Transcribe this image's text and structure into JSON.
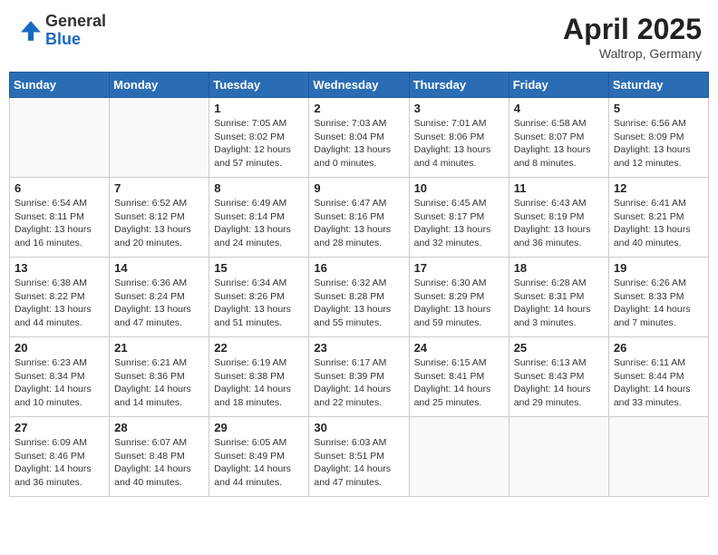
{
  "header": {
    "logo_general": "General",
    "logo_blue": "Blue",
    "title": "April 2025",
    "location": "Waltrop, Germany"
  },
  "weekdays": [
    "Sunday",
    "Monday",
    "Tuesday",
    "Wednesday",
    "Thursday",
    "Friday",
    "Saturday"
  ],
  "weeks": [
    [
      {
        "day": "",
        "info": ""
      },
      {
        "day": "",
        "info": ""
      },
      {
        "day": "1",
        "info": "Sunrise: 7:05 AM\nSunset: 8:02 PM\nDaylight: 12 hours and 57 minutes."
      },
      {
        "day": "2",
        "info": "Sunrise: 7:03 AM\nSunset: 8:04 PM\nDaylight: 13 hours and 0 minutes."
      },
      {
        "day": "3",
        "info": "Sunrise: 7:01 AM\nSunset: 8:06 PM\nDaylight: 13 hours and 4 minutes."
      },
      {
        "day": "4",
        "info": "Sunrise: 6:58 AM\nSunset: 8:07 PM\nDaylight: 13 hours and 8 minutes."
      },
      {
        "day": "5",
        "info": "Sunrise: 6:56 AM\nSunset: 8:09 PM\nDaylight: 13 hours and 12 minutes."
      }
    ],
    [
      {
        "day": "6",
        "info": "Sunrise: 6:54 AM\nSunset: 8:11 PM\nDaylight: 13 hours and 16 minutes."
      },
      {
        "day": "7",
        "info": "Sunrise: 6:52 AM\nSunset: 8:12 PM\nDaylight: 13 hours and 20 minutes."
      },
      {
        "day": "8",
        "info": "Sunrise: 6:49 AM\nSunset: 8:14 PM\nDaylight: 13 hours and 24 minutes."
      },
      {
        "day": "9",
        "info": "Sunrise: 6:47 AM\nSunset: 8:16 PM\nDaylight: 13 hours and 28 minutes."
      },
      {
        "day": "10",
        "info": "Sunrise: 6:45 AM\nSunset: 8:17 PM\nDaylight: 13 hours and 32 minutes."
      },
      {
        "day": "11",
        "info": "Sunrise: 6:43 AM\nSunset: 8:19 PM\nDaylight: 13 hours and 36 minutes."
      },
      {
        "day": "12",
        "info": "Sunrise: 6:41 AM\nSunset: 8:21 PM\nDaylight: 13 hours and 40 minutes."
      }
    ],
    [
      {
        "day": "13",
        "info": "Sunrise: 6:38 AM\nSunset: 8:22 PM\nDaylight: 13 hours and 44 minutes."
      },
      {
        "day": "14",
        "info": "Sunrise: 6:36 AM\nSunset: 8:24 PM\nDaylight: 13 hours and 47 minutes."
      },
      {
        "day": "15",
        "info": "Sunrise: 6:34 AM\nSunset: 8:26 PM\nDaylight: 13 hours and 51 minutes."
      },
      {
        "day": "16",
        "info": "Sunrise: 6:32 AM\nSunset: 8:28 PM\nDaylight: 13 hours and 55 minutes."
      },
      {
        "day": "17",
        "info": "Sunrise: 6:30 AM\nSunset: 8:29 PM\nDaylight: 13 hours and 59 minutes."
      },
      {
        "day": "18",
        "info": "Sunrise: 6:28 AM\nSunset: 8:31 PM\nDaylight: 14 hours and 3 minutes."
      },
      {
        "day": "19",
        "info": "Sunrise: 6:26 AM\nSunset: 8:33 PM\nDaylight: 14 hours and 7 minutes."
      }
    ],
    [
      {
        "day": "20",
        "info": "Sunrise: 6:23 AM\nSunset: 8:34 PM\nDaylight: 14 hours and 10 minutes."
      },
      {
        "day": "21",
        "info": "Sunrise: 6:21 AM\nSunset: 8:36 PM\nDaylight: 14 hours and 14 minutes."
      },
      {
        "day": "22",
        "info": "Sunrise: 6:19 AM\nSunset: 8:38 PM\nDaylight: 14 hours and 18 minutes."
      },
      {
        "day": "23",
        "info": "Sunrise: 6:17 AM\nSunset: 8:39 PM\nDaylight: 14 hours and 22 minutes."
      },
      {
        "day": "24",
        "info": "Sunrise: 6:15 AM\nSunset: 8:41 PM\nDaylight: 14 hours and 25 minutes."
      },
      {
        "day": "25",
        "info": "Sunrise: 6:13 AM\nSunset: 8:43 PM\nDaylight: 14 hours and 29 minutes."
      },
      {
        "day": "26",
        "info": "Sunrise: 6:11 AM\nSunset: 8:44 PM\nDaylight: 14 hours and 33 minutes."
      }
    ],
    [
      {
        "day": "27",
        "info": "Sunrise: 6:09 AM\nSunset: 8:46 PM\nDaylight: 14 hours and 36 minutes."
      },
      {
        "day": "28",
        "info": "Sunrise: 6:07 AM\nSunset: 8:48 PM\nDaylight: 14 hours and 40 minutes."
      },
      {
        "day": "29",
        "info": "Sunrise: 6:05 AM\nSunset: 8:49 PM\nDaylight: 14 hours and 44 minutes."
      },
      {
        "day": "30",
        "info": "Sunrise: 6:03 AM\nSunset: 8:51 PM\nDaylight: 14 hours and 47 minutes."
      },
      {
        "day": "",
        "info": ""
      },
      {
        "day": "",
        "info": ""
      },
      {
        "day": "",
        "info": ""
      }
    ]
  ]
}
